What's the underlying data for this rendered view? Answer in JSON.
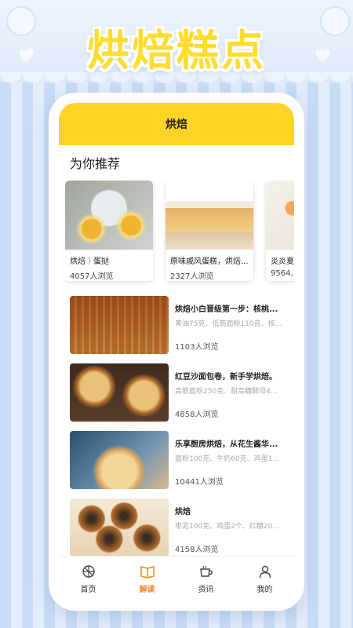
{
  "hero": {
    "title": "烘焙糕点"
  },
  "app": {
    "header_title": "烘焙",
    "section_title": "为你推荐",
    "recommended": [
      {
        "name": "烘焙｜蛋挞",
        "views": "4057人浏览"
      },
      {
        "name": "原味戚风蛋糕，烘焙...",
        "views": "2327人浏览"
      },
      {
        "name": "炎炎夏",
        "views": "9564,"
      }
    ],
    "articles": [
      {
        "title": "烘焙小白晋级第一步：核桃...",
        "ingredients": "黄油75克、低筋面粉110克、核...",
        "views": "1103人浏览"
      },
      {
        "title": "红豆沙面包卷，新手学烘焙。",
        "ingredients": "高筋面粉250克、耐高糖酵母4...",
        "views": "4858人浏览"
      },
      {
        "title": "乐享厨房烘焙，从花生酱华...",
        "ingredients": "面粉100克、牛奶60克、鸡蛋1...",
        "views": "10441人浏览"
      },
      {
        "title": "烘焙",
        "ingredients": "枣泥100克、鸡蛋2个、红糖20...",
        "views": "4158人浏览"
      }
    ],
    "tabs": [
      {
        "label": "首页",
        "icon": "home-icon"
      },
      {
        "label": "解读",
        "icon": "book-icon"
      },
      {
        "label": "资讯",
        "icon": "cup-icon"
      },
      {
        "label": "我的",
        "icon": "person-icon"
      }
    ],
    "colors": {
      "accent": "#ffd426",
      "active_tab": "#f08a1c"
    }
  }
}
